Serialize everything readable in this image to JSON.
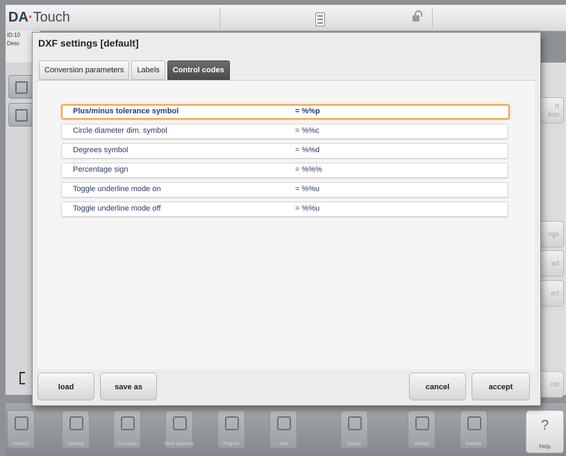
{
  "topbar": {
    "logo_brand": "DA",
    "logo_product": "Touch",
    "calculator_icon": "calculator-icon",
    "lock_icon": "unlocked-padlock-icon"
  },
  "background": {
    "id_label": "ID:10",
    "desc_label": "Desc",
    "right_buttons": [
      "rt\ntion",
      "ngs",
      "ad",
      "ert",
      "cel"
    ]
  },
  "dialog": {
    "title": "DXF settings [default]",
    "tabs": [
      {
        "label": "Conversion parameters",
        "active": false
      },
      {
        "label": "Labels",
        "active": false
      },
      {
        "label": "Control codes",
        "active": true
      }
    ],
    "rows": [
      {
        "label": "Plus/minus tolerance symbol",
        "value": "= %%p",
        "selected": true
      },
      {
        "label": "Circle diameter dim. symbol",
        "value": "= %%c",
        "selected": false
      },
      {
        "label": "Degrees symbol",
        "value": "= %%d",
        "selected": false
      },
      {
        "label": "Percentage sign",
        "value": "= %%%",
        "selected": false
      },
      {
        "label": "Toggle underline mode on",
        "value": "= %%u",
        "selected": false
      },
      {
        "label": "Toggle underline mode off",
        "value": "= %%u",
        "selected": false
      }
    ],
    "buttons": {
      "load": "load",
      "save_as": "save as",
      "cancel": "cancel",
      "accept": "accept"
    }
  },
  "toolbar": {
    "items": [
      {
        "label": "Products",
        "icon": "folder-icon"
      },
      {
        "label": "Drawing",
        "icon": "pencil-icon"
      },
      {
        "label": "Tool setup",
        "icon": "tool-setup-icon"
      },
      {
        "label": "Bend sequence",
        "icon": "bend-sequence-icon"
      },
      {
        "label": "Program",
        "icon": "program-icon"
      },
      {
        "label": "Auto",
        "icon": "play-icon"
      },
      {
        "label": "Manual",
        "icon": "hand-icon"
      },
      {
        "label": "Settings",
        "icon": "settings-list-icon"
      },
      {
        "label": "Machine",
        "icon": "machine-icon"
      }
    ],
    "help": {
      "glyph": "?",
      "label": "Help"
    }
  }
}
